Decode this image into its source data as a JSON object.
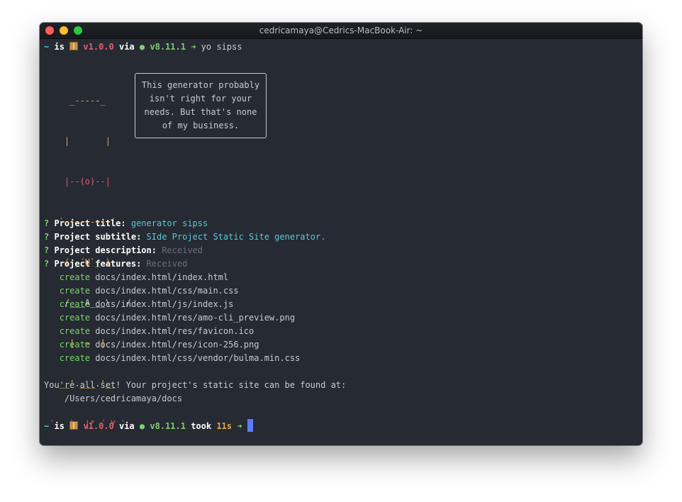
{
  "window": {
    "title": "cedricamaya@Cedrics-MacBook-Air: ~"
  },
  "prompt": {
    "tilde": "~",
    "is": "is",
    "package_icon": "package-icon",
    "version": "v1.0.0",
    "via": "via",
    "node_dot": "●",
    "node_version": "v8.11.1",
    "arrow": "➜",
    "command": "yo sipss",
    "took": "took",
    "duration": "11s"
  },
  "ascii_art": {
    "lines": [
      "     _-----_     ",
      "    |       |    ",
      "    |--(o)--|    ",
      "   `---------´   ",
      "    ( _´U`_ )    ",
      "    /___A___\\   /",
      "     |  ~  |     ",
      "   __'.___.'__   ",
      " ´   `  |° ´ Y ` "
    ]
  },
  "bubble": {
    "lines": [
      "This generator probably",
      "isn't right for your",
      "needs. But that's none",
      "of my business."
    ]
  },
  "questions": [
    {
      "mark": "?",
      "label": "Project title:",
      "answer": "generator sipss",
      "answer_color": "cyan"
    },
    {
      "mark": "?",
      "label": "Project subtitle:",
      "answer": "SIde Project Static Site generator.",
      "answer_color": "cyan"
    },
    {
      "mark": "?",
      "label": "Project description:",
      "answer": "Received",
      "answer_color": "gray"
    },
    {
      "mark": "?",
      "label": "Project features:",
      "answer": "Received",
      "answer_color": "gray"
    }
  ],
  "created_files": {
    "verb": "create",
    "paths": [
      "docs/index.html/index.html",
      "docs/index.html/css/main.css",
      "docs/index.html/js/index.js",
      "docs/index.html/res/amo-cli_preview.png",
      "docs/index.html/res/favicon.ico",
      "docs/index.html/res/icon-256.png",
      "docs/index.html/css/vendor/bulma.min.css"
    ]
  },
  "done_message": "You're all set! Your project's static site can be found at:",
  "output_path": "/Users/cedricamaya/docs",
  "colors": {
    "background": "#262a32",
    "cyan": "#5ac8d8",
    "red": "#e0606e",
    "green": "#7dd16e",
    "cursor": "#5b7cff"
  }
}
